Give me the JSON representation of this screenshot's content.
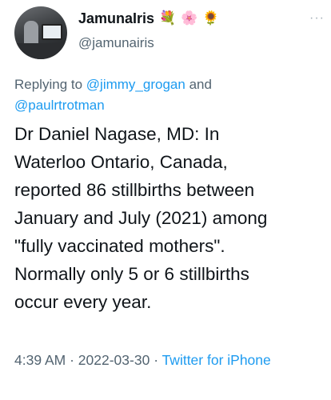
{
  "author": {
    "display_name": "JamunaIris",
    "emojis": [
      "💐",
      "🌸",
      "🌻"
    ],
    "handle": "@jamunairis"
  },
  "more_icon": "more-horizontal-icon",
  "reply": {
    "prefix": "Replying to",
    "mention_1": "@jimmy_grogan",
    "conjunction": "and",
    "mention_2": "@paulrtrotman"
  },
  "tweet_lines": [
    "Dr Daniel Nagase, MD: In",
    "Waterloo Ontario, Canada,",
    "reported 86 stillbirths between",
    "January and July (2021) among",
    "\"fully vaccinated mothers\".",
    "Normally only 5 or 6 stillbirths",
    "occur every year."
  ],
  "meta": {
    "time": "4:39 AM",
    "separator": "·",
    "date": "2022-03-30",
    "source": "Twitter for iPhone"
  },
  "colors": {
    "link": "#1d9bf0",
    "secondary_text": "#536471",
    "primary_text": "#0f1419"
  }
}
